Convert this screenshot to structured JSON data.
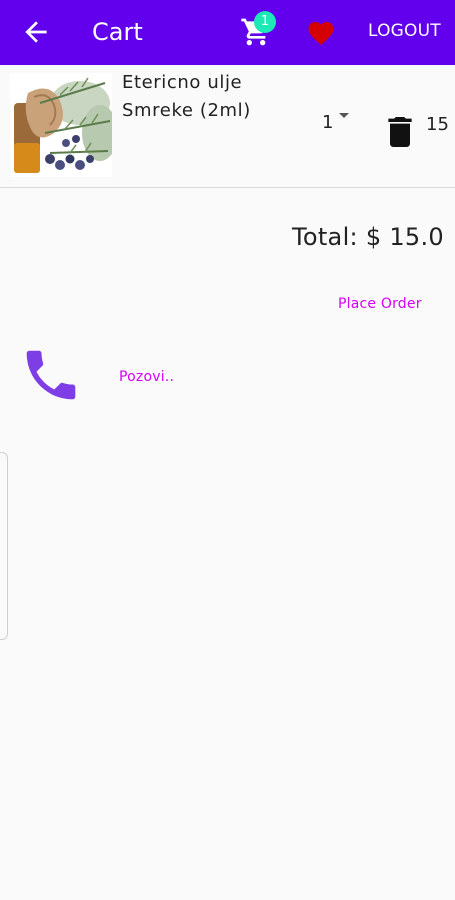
{
  "appbar": {
    "title": "Cart",
    "cart_badge": "1",
    "logout_label": "LOGOUT",
    "colors": {
      "bar": "#6200ee",
      "badge": "#1de9b6",
      "heart": "#d50000"
    },
    "icons": {
      "back": "arrow-left-icon",
      "cart": "shopping-cart-icon",
      "favorite": "heart-icon"
    }
  },
  "cart": {
    "items": [
      {
        "name": "Etericno ulje Smreke (2ml)",
        "quantity": "1",
        "price": "15",
        "image_icon": "juniper-oil-product-image"
      }
    ],
    "total": "Total: $ 15.0",
    "place_order_label": "Place Order"
  },
  "contact": {
    "call_label": "Pozovi..",
    "icon": "phone-icon",
    "icon_color": "#7e3ee6"
  },
  "accent_color": "#d500f9"
}
